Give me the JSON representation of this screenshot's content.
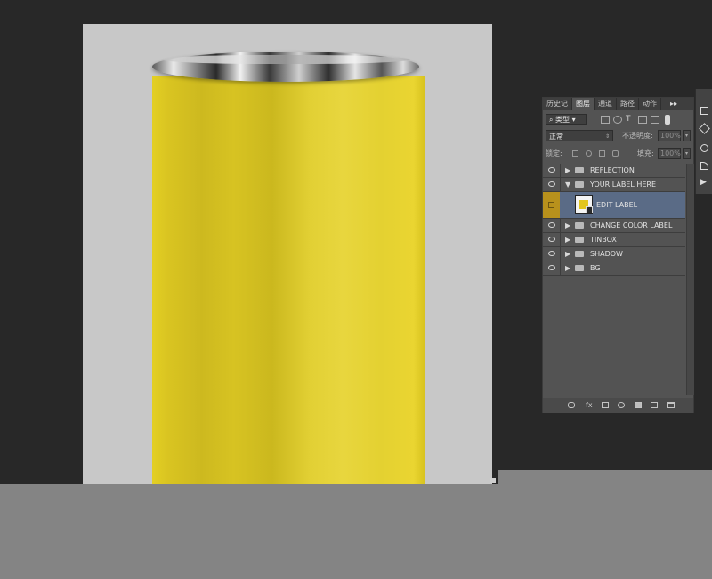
{
  "panel": {
    "tabs": [
      "历史记",
      "图层",
      "通道",
      "路径",
      "动作"
    ],
    "active_tab": "图层",
    "menu_glyph": "▸▸",
    "filter_label": "类型",
    "blend_mode": "正常",
    "opacity_label": "不透明度:",
    "opacity_value": "100%",
    "lock_label": "锁定:",
    "fill_label": "填充:",
    "fill_value": "100%"
  },
  "layers": [
    {
      "name": "REFLECTION",
      "expanded": false
    },
    {
      "name": "YOUR LABEL HERE",
      "expanded": true
    },
    {
      "name": "EDIT LABEL",
      "selected": true
    },
    {
      "name": "CHANGE COLOR LABEL",
      "expanded": false
    },
    {
      "name": "TINBOX",
      "expanded": false
    },
    {
      "name": "SHADOW",
      "expanded": false
    },
    {
      "name": "BG",
      "expanded": false
    }
  ],
  "colors": {
    "workspace": "#282828",
    "canvas": "#c8c8c8",
    "can_yellow": "#e0cc2c",
    "panel": "#535353",
    "selection": "#5a6b86"
  },
  "icons": [
    "eye-icon",
    "folder-icon",
    "expand-arrow-icon",
    "link-icon",
    "fx-icon",
    "mask-icon",
    "adjustment-icon",
    "new-group-icon",
    "new-layer-icon",
    "trash-icon"
  ]
}
